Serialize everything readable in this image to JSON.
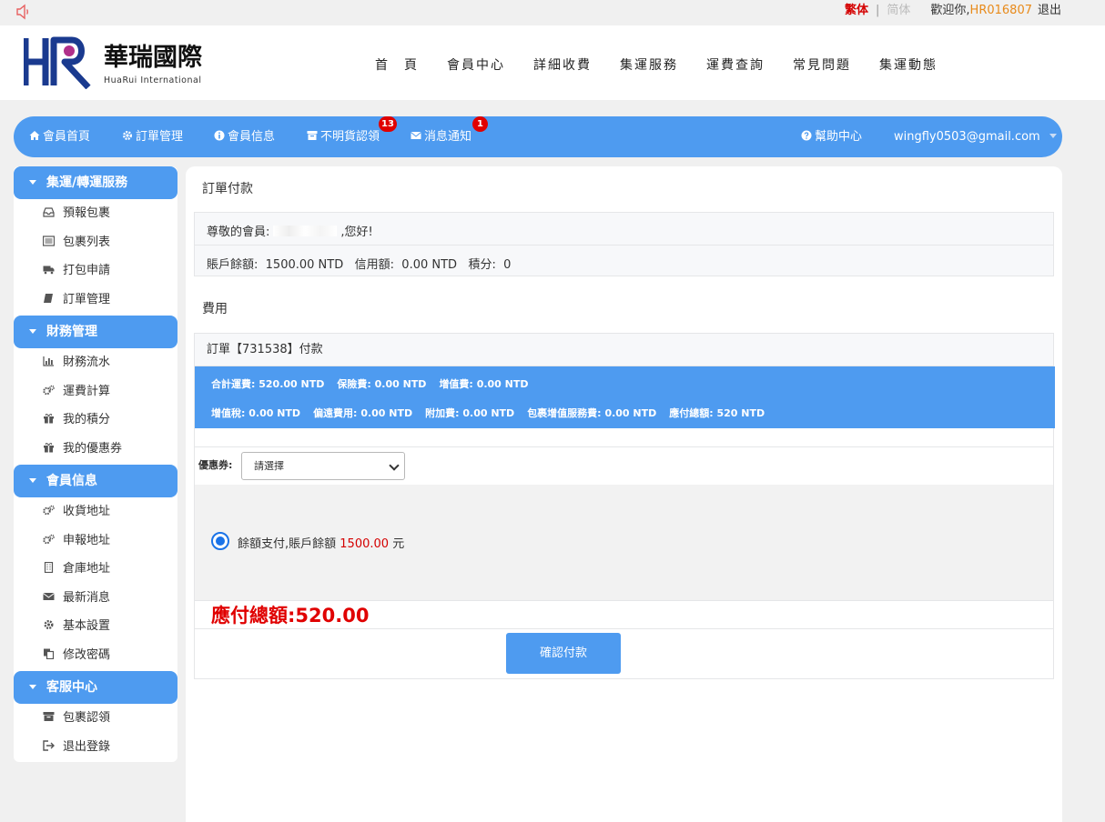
{
  "top": {
    "trad": "繁体",
    "sep": "|",
    "simp": "简体",
    "welcome": "歡迎你,",
    "user_id": "HR016807",
    "logout": "退出"
  },
  "logo": {
    "mark": "HR",
    "name": "華瑞國際",
    "sub": "HuaRui International",
    "accent": "#1a3a8f",
    "accent2": "#b0308a"
  },
  "nav": [
    "首　頁",
    "會員中心",
    "詳細收費",
    "集運服務",
    "運費查詢",
    "常見問題",
    "集運動態"
  ],
  "member_bar": {
    "home": "會員首頁",
    "orders": "訂單管理",
    "info": "會員信息",
    "unclaimed": "不明貨認領",
    "unclaimed_badge": "13",
    "messages": "消息通知",
    "messages_badge": "1",
    "help": "幫助中心",
    "email": "wingfly0503@gmail.com"
  },
  "sidebar": {
    "sections": [
      {
        "title": "集運/轉運服務",
        "items": [
          "預報包裹",
          "包裹列表",
          "打包申請",
          "訂單管理"
        ]
      },
      {
        "title": "財務管理",
        "items": [
          "財務流水",
          "運費計算",
          "我的積分",
          "我的優惠券"
        ]
      },
      {
        "title": "會員信息",
        "items": [
          "收貨地址",
          "申報地址",
          "倉庫地址",
          "最新消息",
          "基本設置",
          "修改密碼"
        ]
      },
      {
        "title": "客服中心",
        "items": [
          "包裹認領",
          "退出登錄"
        ]
      }
    ]
  },
  "main": {
    "title": "訂單付款",
    "greeting_prefix": "尊敬的會員:",
    "greeting_suffix": ",您好!",
    "balance_label": "賬戶餘額:",
    "balance": "1500.00 NTD",
    "credit_label": "信用額:",
    "credit": "0.00 NTD",
    "points_label": "積分:",
    "points": "0",
    "fee_title": "費用",
    "order_head": "訂單【731538】付款",
    "fees_line1": [
      {
        "label": "合計運費:",
        "value": "520.00 NTD"
      },
      {
        "label": "保險費:",
        "value": "0.00 NTD"
      },
      {
        "label": "增值費:",
        "value": "0.00 NTD"
      }
    ],
    "fees_line2": [
      {
        "label": "增值稅:",
        "value": "0.00 NTD"
      },
      {
        "label": "偏遠費用:",
        "value": "0.00 NTD"
      },
      {
        "label": "附加費:",
        "value": "0.00 NTD"
      },
      {
        "label": "包裹增值服務費:",
        "value": "0.00 NTD"
      },
      {
        "label": "應付總額:",
        "value": "520 NTD"
      }
    ],
    "coupon_label": "優惠券:",
    "coupon_selected": "請選擇",
    "pay_option_prefix": "餘額支付,賬戶餘額",
    "pay_option_amount": "1500.00",
    "pay_option_unit": "元",
    "total_label": "應付總額:",
    "total_value": "520.00",
    "confirm": "確認付款"
  }
}
